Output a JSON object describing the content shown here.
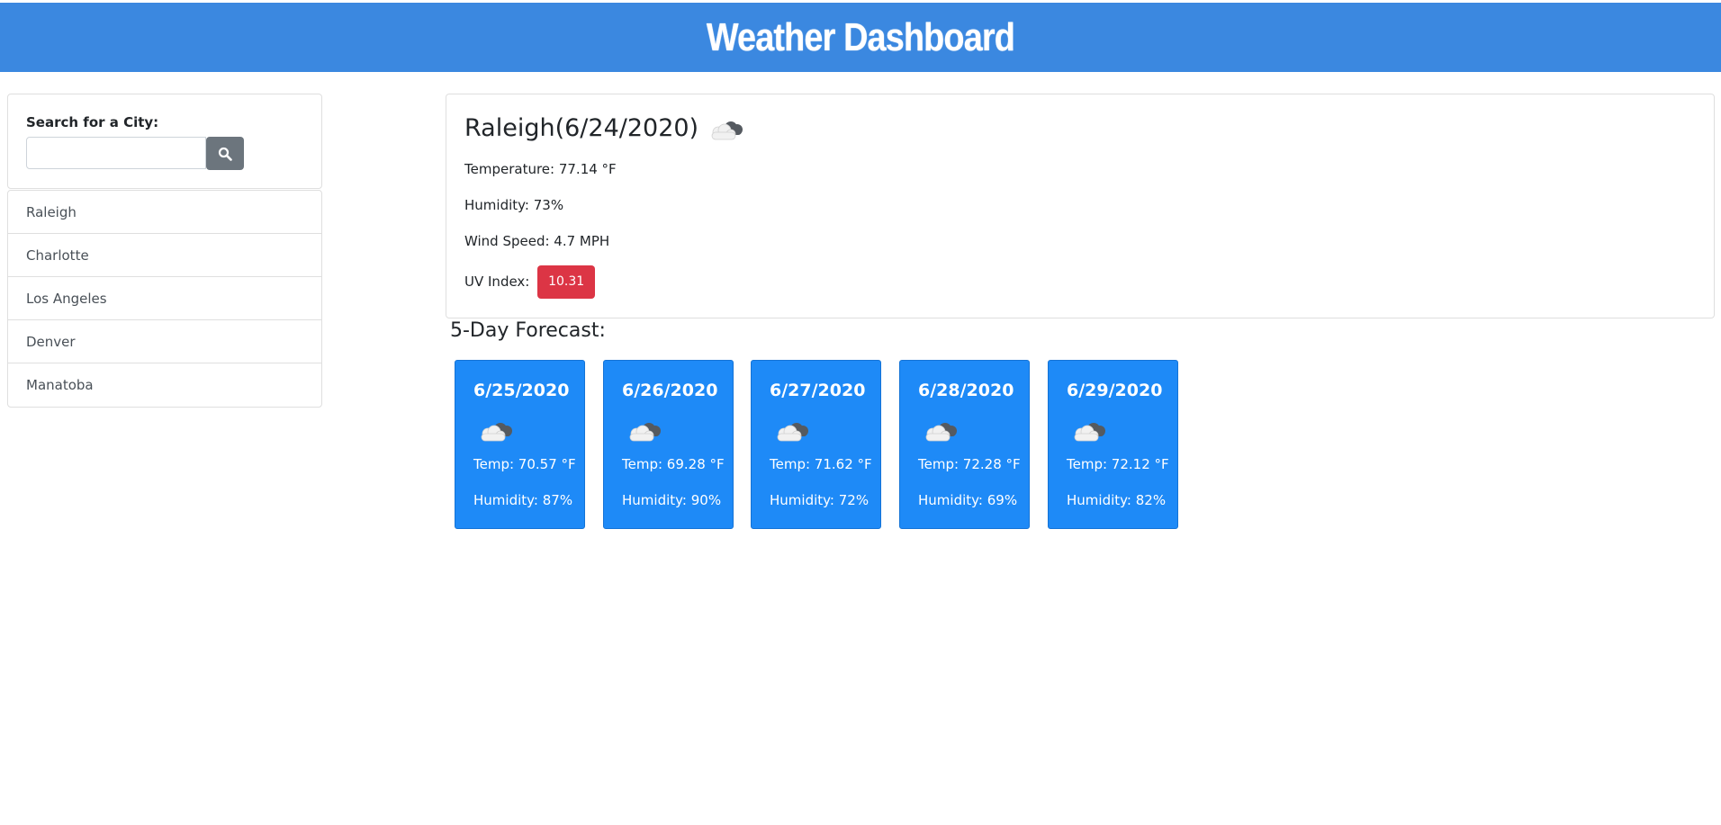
{
  "header": {
    "title": "Weather Dashboard"
  },
  "search": {
    "label": "Search for a City:",
    "value": "",
    "placeholder": "",
    "button_icon": "search-icon"
  },
  "cities": [
    "Raleigh",
    "Charlotte",
    "Los Angeles",
    "Denver",
    "Manatoba"
  ],
  "current": {
    "title": "Raleigh(6/24/2020)",
    "icon": "cloud-icon",
    "temperature": "Temperature: 77.14 °F",
    "humidity": "Humidity: 73%",
    "wind": "Wind Speed: 4.7 MPH",
    "uv_label": "UV Index:",
    "uv_value": "10.31",
    "uv_color": "#dc3545"
  },
  "forecast": {
    "heading": "5-Day Forecast:",
    "card_color": "#1e8af7",
    "days": [
      {
        "date": "6/25/2020",
        "icon": "cloud-icon",
        "temp": "Temp: 70.57 °F",
        "humidity": "Humidity: 87%"
      },
      {
        "date": "6/26/2020",
        "icon": "cloud-icon",
        "temp": "Temp: 69.28 °F",
        "humidity": "Humidity: 90%"
      },
      {
        "date": "6/27/2020",
        "icon": "cloud-icon",
        "temp": "Temp: 71.62 °F",
        "humidity": "Humidity: 72%"
      },
      {
        "date": "6/28/2020",
        "icon": "cloud-icon",
        "temp": "Temp: 72.28 °F",
        "humidity": "Humidity: 69%"
      },
      {
        "date": "6/29/2020",
        "icon": "cloud-icon",
        "temp": "Temp: 72.12 °F",
        "humidity": "Humidity: 82%"
      }
    ]
  },
  "colors": {
    "header_bg": "#3b88e0",
    "search_button": "#6c757d"
  }
}
